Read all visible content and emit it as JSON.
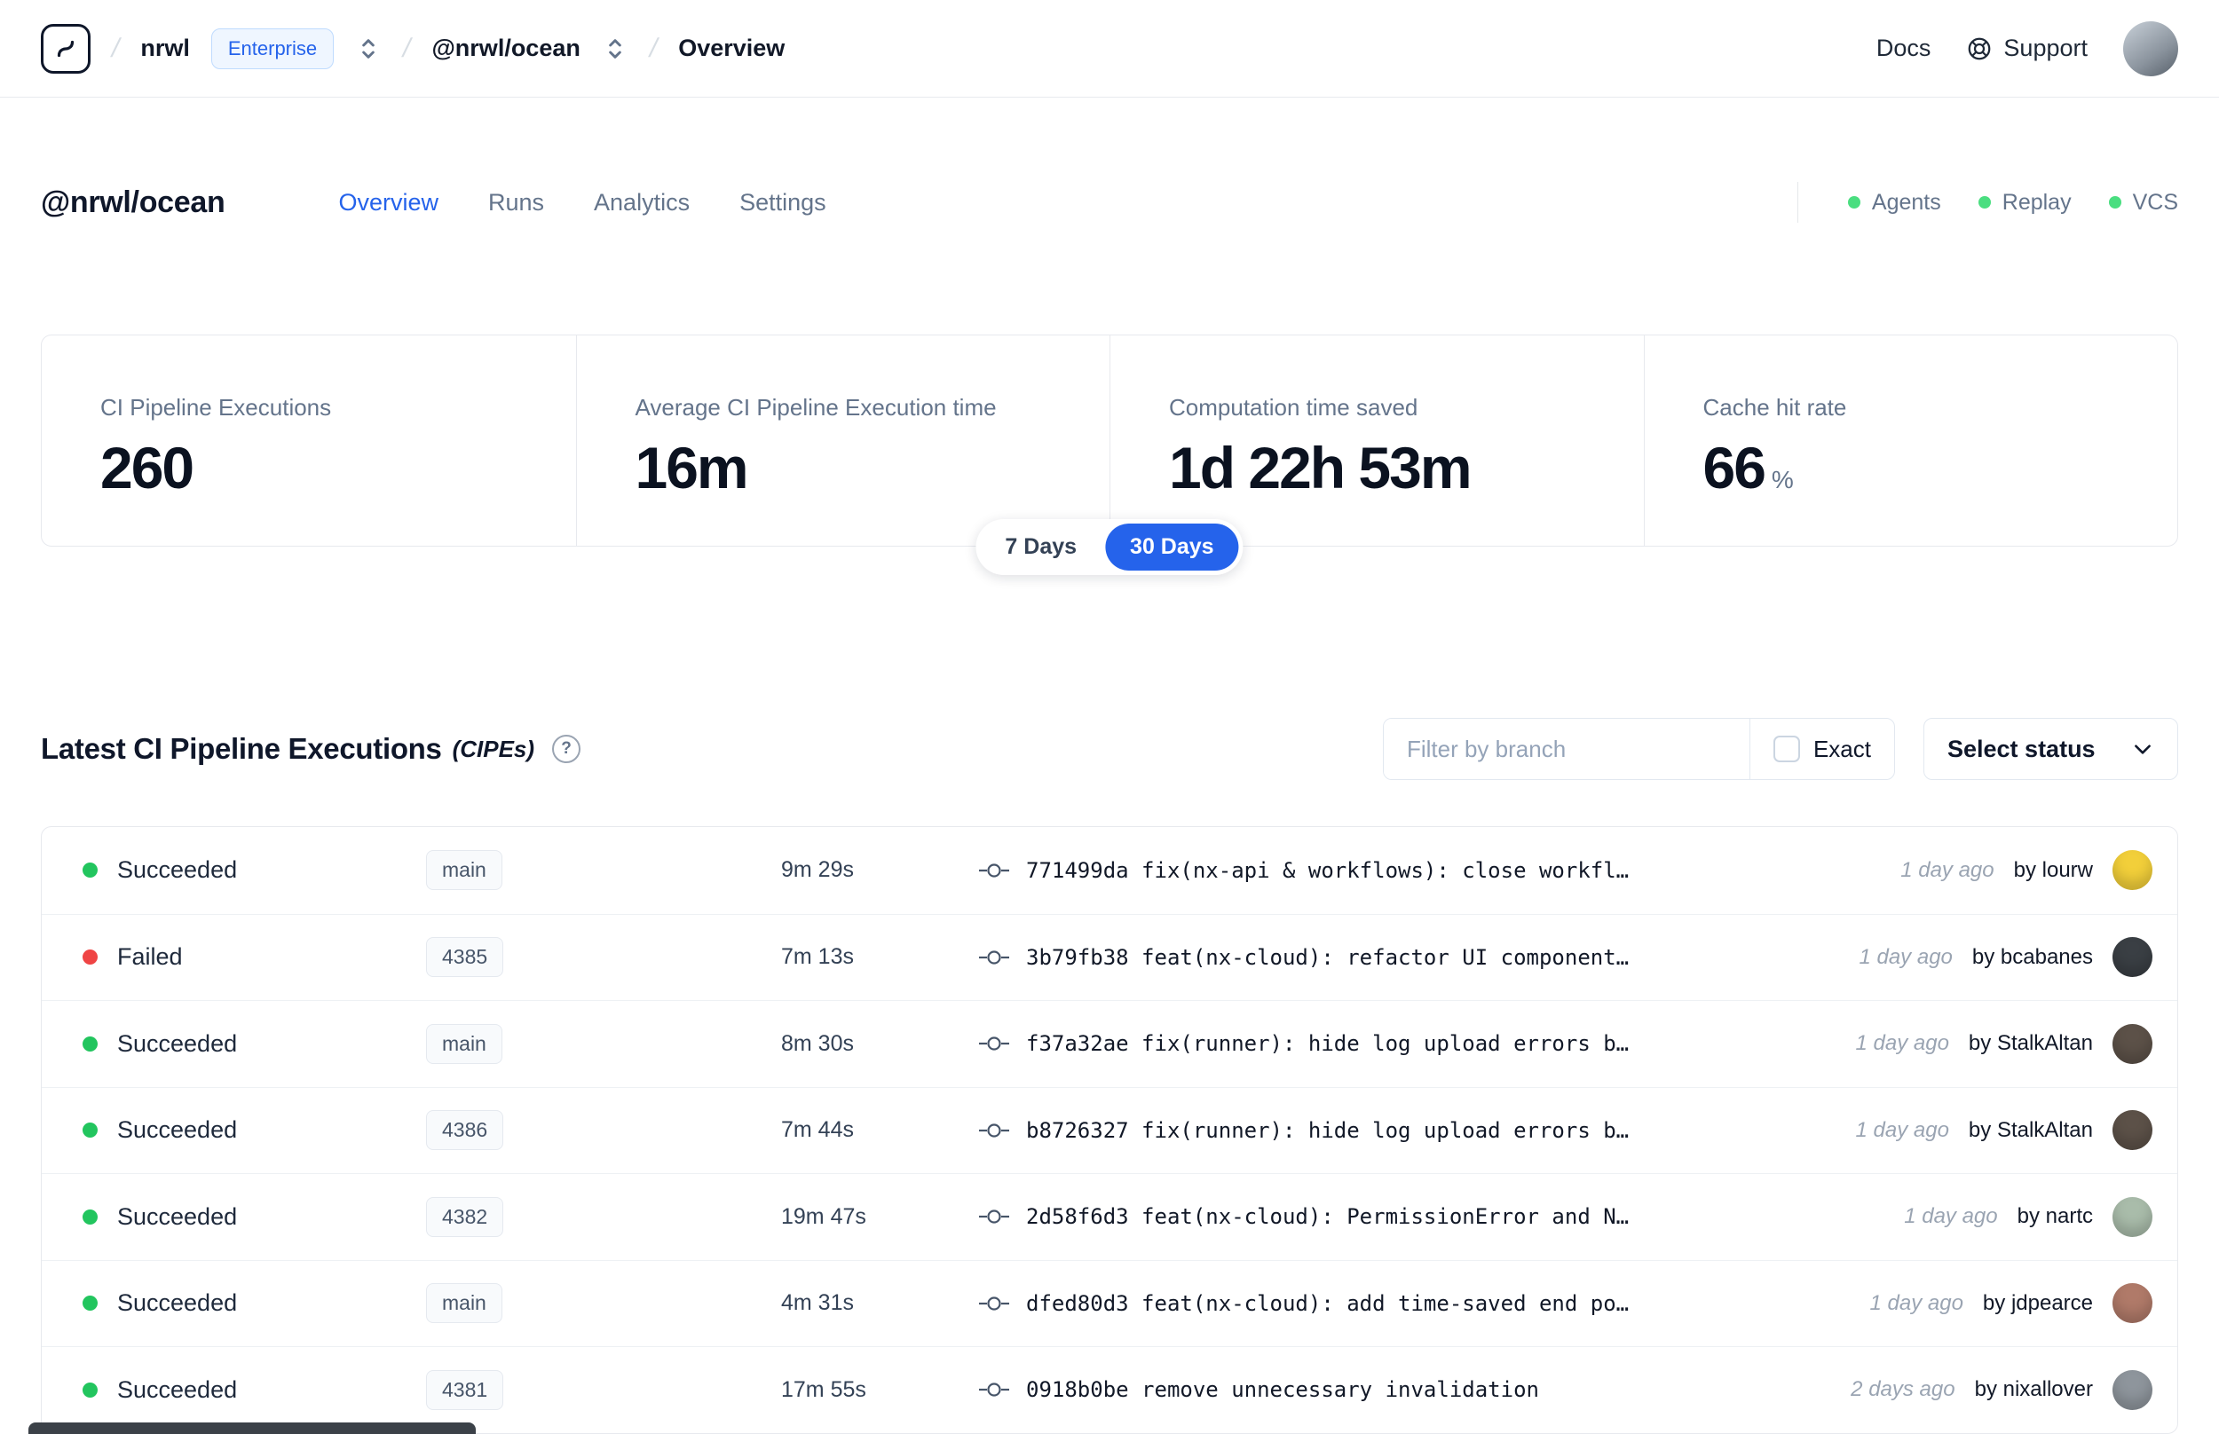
{
  "colors": {
    "accent": "#2563eb",
    "success": "#22c55e",
    "failed": "#ef4444",
    "indicator_green": "#4ade80"
  },
  "topbar": {
    "breadcrumb": {
      "org": "nrwl",
      "org_badge": "Enterprise",
      "workspace": "@nrwl/ocean",
      "page": "Overview"
    },
    "links": {
      "docs": "Docs",
      "support": "Support"
    }
  },
  "header": {
    "title": "@nrwl/ocean",
    "tabs": [
      {
        "label": "Overview",
        "active": true
      },
      {
        "label": "Runs",
        "active": false
      },
      {
        "label": "Analytics",
        "active": false
      },
      {
        "label": "Settings",
        "active": false
      }
    ],
    "indicators": [
      {
        "label": "Agents"
      },
      {
        "label": "Replay"
      },
      {
        "label": "VCS"
      }
    ]
  },
  "stats": {
    "cards": [
      {
        "label": "CI Pipeline Executions",
        "value": "260",
        "unit": ""
      },
      {
        "label": "Average CI Pipeline Execution time",
        "value": "16m",
        "unit": ""
      },
      {
        "label": "Computation time saved",
        "value": "1d 22h 53m",
        "unit": ""
      },
      {
        "label": "Cache hit rate",
        "value": "66",
        "unit": "%"
      }
    ],
    "range_toggle": [
      {
        "label": "7 Days",
        "active": false
      },
      {
        "label": "30 Days",
        "active": true
      }
    ]
  },
  "cipes": {
    "title": "Latest CI Pipeline Executions",
    "title_suffix": "(CIPEs)",
    "filter": {
      "placeholder": "Filter by branch",
      "exact_label": "Exact"
    },
    "status_dropdown_label": "Select status",
    "rows": [
      {
        "status": "Succeeded",
        "status_color": "#22c55e",
        "branch": "main",
        "duration": "9m 29s",
        "commit": "771499da fix(nx-api & workflows): close workfl…",
        "time": "1 day ago",
        "author": "by lourw",
        "avatar_color": "#f2cf3a"
      },
      {
        "status": "Failed",
        "status_color": "#ef4444",
        "branch": "4385",
        "duration": "7m 13s",
        "commit": "3b79fb38 feat(nx-cloud): refactor UI component…",
        "time": "1 day ago",
        "author": "by bcabanes",
        "avatar_color": "#3a3f44"
      },
      {
        "status": "Succeeded",
        "status_color": "#22c55e",
        "branch": "main",
        "duration": "8m 30s",
        "commit": "f37a32ae fix(runner): hide log upload errors b…",
        "time": "1 day ago",
        "author": "by StalkAltan",
        "avatar_color": "#5c5148"
      },
      {
        "status": "Succeeded",
        "status_color": "#22c55e",
        "branch": "4386",
        "duration": "7m 44s",
        "commit": "b8726327 fix(runner): hide log upload errors b…",
        "time": "1 day ago",
        "author": "by StalkAltan",
        "avatar_color": "#5c5148"
      },
      {
        "status": "Succeeded",
        "status_color": "#22c55e",
        "branch": "4382",
        "duration": "19m 47s",
        "commit": "2d58f6d3 feat(nx-cloud): PermissionError and N…",
        "time": "1 day ago",
        "author": "by nartc",
        "avatar_color": "#a9bcaa"
      },
      {
        "status": "Succeeded",
        "status_color": "#22c55e",
        "branch": "main",
        "duration": "4m 31s",
        "commit": "dfed80d3 feat(nx-cloud): add time-saved end po…",
        "time": "1 day ago",
        "author": "by jdpearce",
        "avatar_color": "#b07a69"
      },
      {
        "status": "Succeeded",
        "status_color": "#22c55e",
        "branch": "4381",
        "duration": "17m 55s",
        "commit": "0918b0be remove unnecessary invalidation",
        "time": "2 days ago",
        "author": "by nixallover",
        "avatar_color": "#8e959c"
      }
    ]
  }
}
